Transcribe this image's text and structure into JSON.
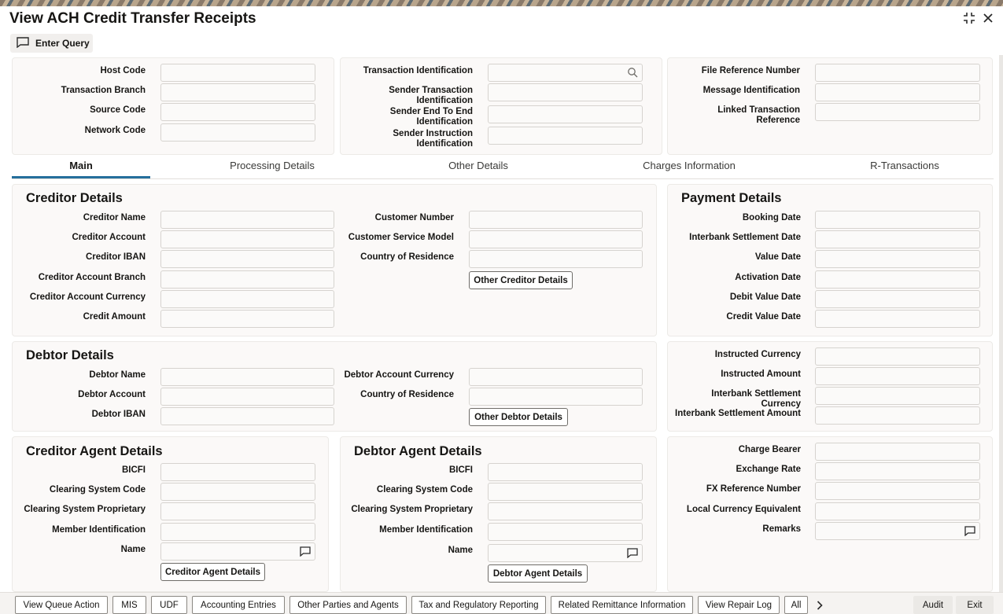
{
  "window": {
    "title": "View ACH Credit Transfer Receipts"
  },
  "toolbar": {
    "enter_query": "Enter Query"
  },
  "header": {
    "left": [
      "Host Code",
      "Transaction Branch",
      "Source Code",
      "Network Code"
    ],
    "middle": [
      "Transaction Identification",
      "Sender Transaction Identification",
      "Sender End To End Identification",
      "Sender Instruction Identification"
    ],
    "right": [
      "File Reference Number",
      "Message Identification",
      "Linked Transaction Reference"
    ]
  },
  "tabs": [
    "Main",
    "Processing Details",
    "Other Details",
    "Charges Information",
    "R-Transactions"
  ],
  "creditor": {
    "title": "Creditor Details",
    "left": [
      "Creditor Name",
      "Creditor Account",
      "Creditor IBAN",
      "Creditor Account Branch",
      "Creditor Account Currency",
      "Credit Amount"
    ],
    "right": [
      "Customer Number",
      "Customer Service Model",
      "Country of Residence"
    ],
    "button": "Other Creditor Details"
  },
  "payment": {
    "title": "Payment Details",
    "fields": [
      "Booking Date",
      "Interbank Settlement Date",
      "Value Date",
      "Activation Date",
      "Debit Value Date",
      "Credit Value Date"
    ]
  },
  "debtor": {
    "title": "Debtor Details",
    "left": [
      "Debtor Name",
      "Debtor Account",
      "Debtor IBAN"
    ],
    "right": [
      "Debtor Account Currency",
      "Country of Residence"
    ],
    "button": "Other Debtor Details"
  },
  "amounts": {
    "fields": [
      "Instructed Currency",
      "Instructed Amount",
      "Interbank Settlement Currency",
      "Interbank Settlement Amount"
    ]
  },
  "creditor_agent": {
    "title": "Creditor Agent Details",
    "fields": [
      "BICFI",
      "Clearing System Code",
      "Clearing System Proprietary",
      "Member Identification",
      "Name"
    ],
    "button": "Creditor Agent Details"
  },
  "debtor_agent": {
    "title": "Debtor Agent Details",
    "fields": [
      "BICFI",
      "Clearing System Code",
      "Clearing System Proprietary",
      "Member Identification",
      "Name"
    ],
    "button": "Debtor Agent Details"
  },
  "charges": {
    "fields": [
      "Charge Bearer",
      "Exchange Rate",
      "FX Reference Number",
      "Local Currency Equivalent",
      "Remarks"
    ]
  },
  "footer": {
    "buttons": [
      "View Queue Action",
      "MIS",
      "UDF",
      "Accounting Entries",
      "Other Parties and Agents",
      "Tax and Regulatory Reporting",
      "Related Remittance Information",
      "View Repair Log",
      "All"
    ],
    "audit": "Audit",
    "exit": "Exit"
  }
}
